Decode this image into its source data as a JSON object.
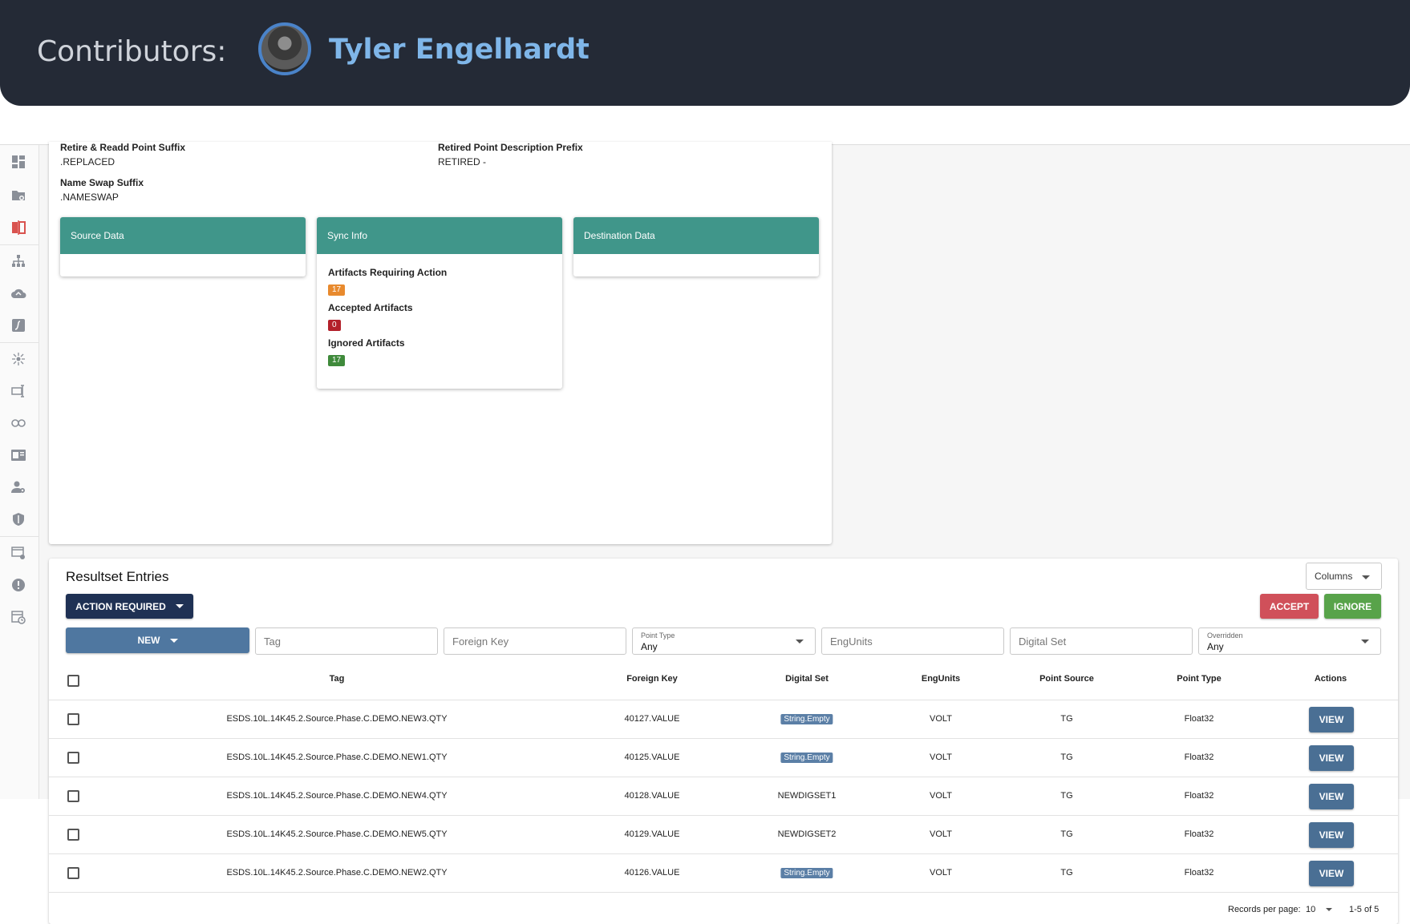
{
  "banner": {
    "label": "Contributors:",
    "name": "Tyler Engelhardt"
  },
  "settings": {
    "retire_suffix_label": "Retire & Readd Point Suffix",
    "retire_suffix_value": ".REPLACED",
    "retired_prefix_label": "Retired Point Description Prefix",
    "retired_prefix_value": "RETIRED -",
    "name_swap_label": "Name Swap Suffix",
    "name_swap_value": ".NAMESWAP"
  },
  "cards": {
    "source": "Source Data",
    "sync": "Sync Info",
    "destination": "Destination Data",
    "requiring_label": "Artifacts Requiring Action",
    "requiring_count": "17",
    "accepted_label": "Accepted Artifacts",
    "accepted_count": "0",
    "ignored_label": "Ignored Artifacts",
    "ignored_count": "17"
  },
  "colors": {
    "teal_header": "#40968a",
    "navy": "#1f3154",
    "accept": "#d0505a",
    "ignore": "#58a34a",
    "orange_badge": "#e88a2e",
    "red_badge": "#b3202a",
    "green_badge": "#3f8a3b"
  },
  "resultset": {
    "title": "Resultset Entries",
    "columns_btn": "Columns",
    "action_required": "ACTION REQUIRED",
    "accept": "ACCEPT",
    "ignore": "IGNORE",
    "new_btn": "NEW",
    "filters": {
      "tag": "Tag",
      "foreign_key": "Foreign Key",
      "point_type_label": "Point Type",
      "point_type_value": "Any",
      "engunits": "EngUnits",
      "digital_set": "Digital Set",
      "overridden_label": "Overridden",
      "overridden_value": "Any"
    },
    "headers": [
      "Tag",
      "Foreign Key",
      "Digital Set",
      "EngUnits",
      "Point Source",
      "Point Type",
      "Actions"
    ],
    "rows": [
      {
        "tag": "ESDS.10L.14K45.2.Source.Phase.C.DEMO.NEW3.QTY",
        "fk": "40127.VALUE",
        "ds": "String.Empty",
        "ds_chip": true,
        "eu": "VOLT",
        "ps": "TG",
        "pt": "Float32",
        "action": "VIEW"
      },
      {
        "tag": "ESDS.10L.14K45.2.Source.Phase.C.DEMO.NEW1.QTY",
        "fk": "40125.VALUE",
        "ds": "String.Empty",
        "ds_chip": true,
        "eu": "VOLT",
        "ps": "TG",
        "pt": "Float32",
        "action": "VIEW"
      },
      {
        "tag": "ESDS.10L.14K45.2.Source.Phase.C.DEMO.NEW4.QTY",
        "fk": "40128.VALUE",
        "ds": "NEWDIGSET1",
        "ds_chip": false,
        "eu": "VOLT",
        "ps": "TG",
        "pt": "Float32",
        "action": "VIEW"
      },
      {
        "tag": "ESDS.10L.14K45.2.Source.Phase.C.DEMO.NEW5.QTY",
        "fk": "40129.VALUE",
        "ds": "NEWDIGSET2",
        "ds_chip": false,
        "eu": "VOLT",
        "ps": "TG",
        "pt": "Float32",
        "action": "VIEW"
      },
      {
        "tag": "ESDS.10L.14K45.2.Source.Phase.C.DEMO.NEW2.QTY",
        "fk": "40126.VALUE",
        "ds": "String.Empty",
        "ds_chip": true,
        "eu": "VOLT",
        "ps": "TG",
        "pt": "Float32",
        "action": "VIEW"
      }
    ],
    "footer": {
      "records_label": "Records per page:",
      "records_value": "10",
      "range": "1-5 of 5"
    }
  }
}
